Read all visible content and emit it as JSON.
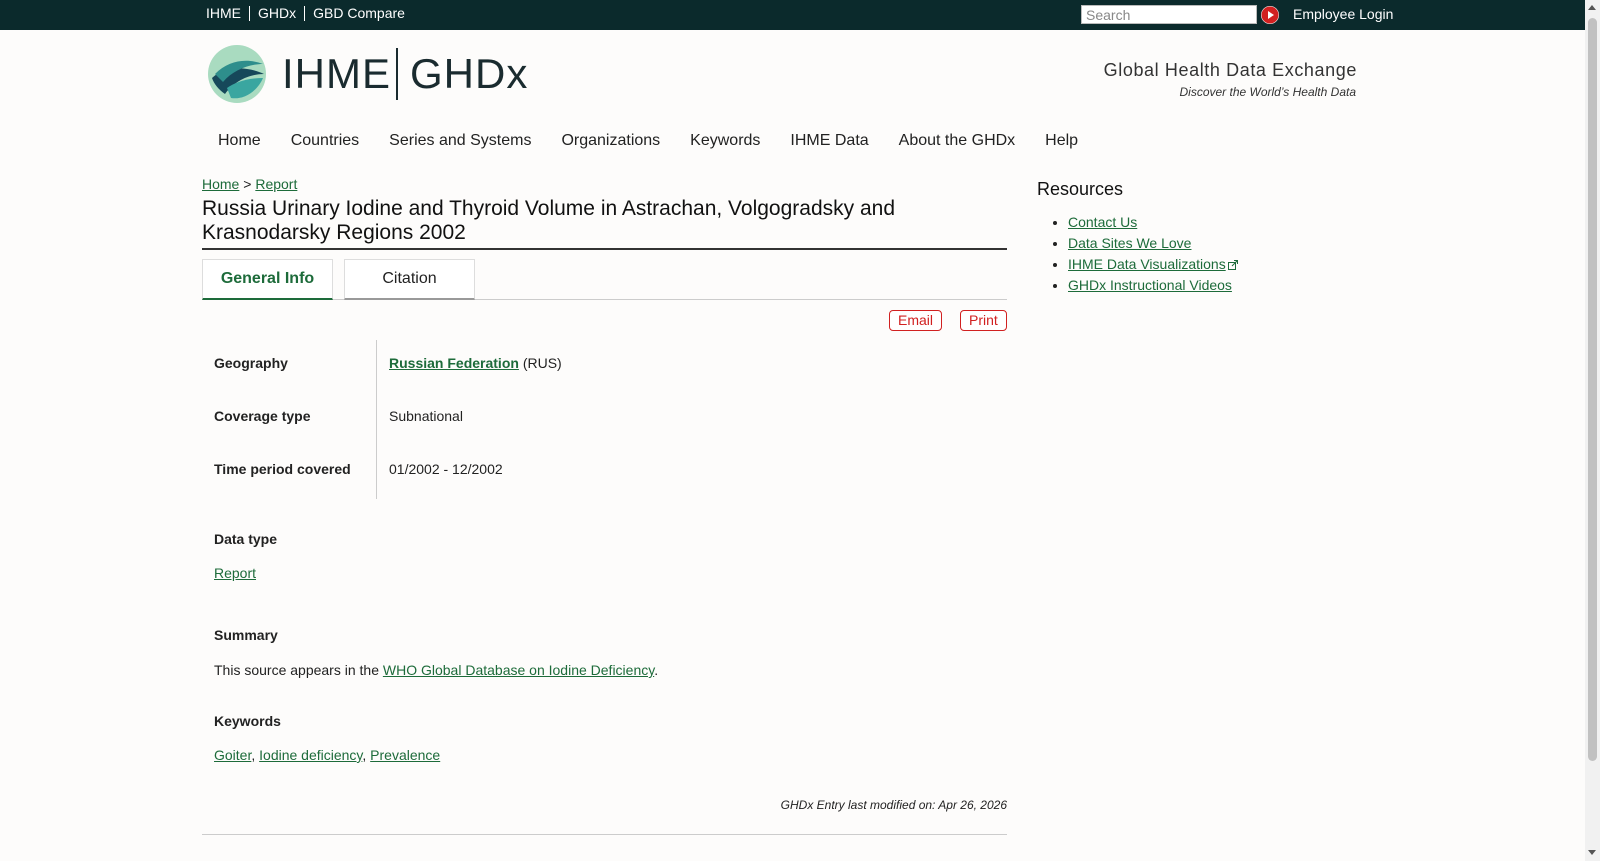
{
  "topbar": {
    "links": [
      "IHME",
      "GHDx",
      "GBD Compare"
    ],
    "search_placeholder": "Search",
    "employee_login": "Employee Login"
  },
  "header": {
    "logo_left": "IHME",
    "logo_right": "GHDx",
    "tagline": "Global Health Data Exchange",
    "subtagline": "Discover the World’s Health Data"
  },
  "nav": [
    "Home",
    "Countries",
    "Series and Systems",
    "Organizations",
    "Keywords",
    "IHME Data",
    "About the GHDx",
    "Help"
  ],
  "breadcrumb": {
    "home": "Home",
    "sep": ">",
    "current": "Report"
  },
  "title": "Russia Urinary Iodine and Thyroid Volume in Astrachan, Volgogradsky and Krasnodarsky Regions 2002",
  "tabs": [
    "General Info",
    "Citation"
  ],
  "actions": {
    "email": "Email",
    "print": "Print"
  },
  "info": {
    "geography_label": "Geography",
    "geography_link": "Russian Federation",
    "geography_code": "(RUS)",
    "coverage_label": "Coverage type",
    "coverage_value": "Subnational",
    "time_label": "Time period covered",
    "time_value": "01/2002 - 12/2002"
  },
  "data_type": {
    "label": "Data type",
    "value": "Report"
  },
  "summary": {
    "label": "Summary",
    "prefix": "This source appears in the ",
    "link": "WHO Global Database on Iodine Deficiency",
    "suffix": "."
  },
  "keywords": {
    "label": "Keywords",
    "items": [
      "Goiter",
      "Iodine deficiency",
      "Prevalence"
    ]
  },
  "modified": "GHDx Entry last modified on: Apr 26, 2026",
  "resources": {
    "title": "Resources",
    "items": [
      "Contact Us",
      "Data Sites We Love",
      "IHME Data Visualizations",
      "GHDx Instructional Videos"
    ]
  },
  "colors": {
    "topbar": "#0b2a2c",
    "link": "#1d6b3a",
    "action_red": "#d12020"
  }
}
